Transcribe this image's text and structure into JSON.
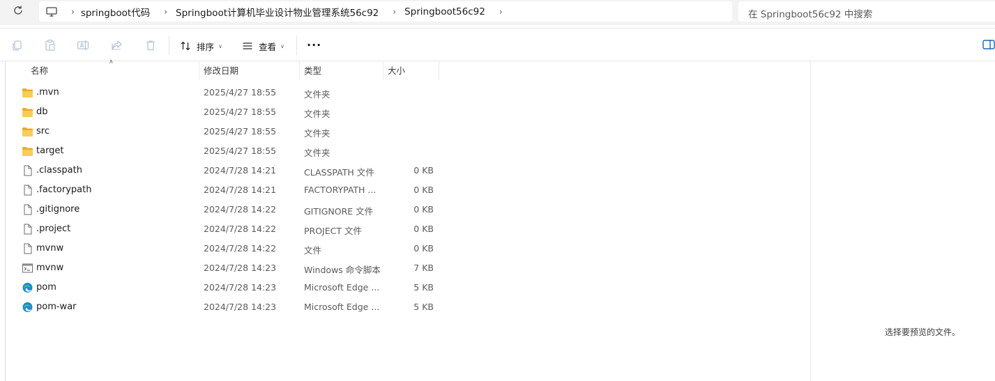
{
  "address_bar": {
    "breadcrumbs": [
      "springboot代码",
      "Springboot计算机毕业设计物业管理系统56c92",
      "Springboot56c92"
    ],
    "search_placeholder": "在 Springboot56c92 中搜索"
  },
  "toolbar": {
    "sort_label": "排序",
    "view_label": "查看",
    "more_label": "···"
  },
  "columns": {
    "name": "名称",
    "modified": "修改日期",
    "type": "类型",
    "size": "大小"
  },
  "files": [
    {
      "name": ".mvn",
      "modified": "2025/4/27 18:55",
      "type": "文件夹",
      "size": "",
      "icon": "folder-icon"
    },
    {
      "name": "db",
      "modified": "2025/4/27 18:55",
      "type": "文件夹",
      "size": "",
      "icon": "folder-icon"
    },
    {
      "name": "src",
      "modified": "2025/4/27 18:55",
      "type": "文件夹",
      "size": "",
      "icon": "folder-icon"
    },
    {
      "name": "target",
      "modified": "2025/4/27 18:55",
      "type": "文件夹",
      "size": "",
      "icon": "folder-icon"
    },
    {
      "name": ".classpath",
      "modified": "2024/7/28 14:21",
      "type": "CLASSPATH 文件",
      "size": "0 KB",
      "icon": "file-icon"
    },
    {
      "name": ".factorypath",
      "modified": "2024/7/28 14:21",
      "type": "FACTORYPATH ...",
      "size": "0 KB",
      "icon": "file-icon"
    },
    {
      "name": ".gitignore",
      "modified": "2024/7/28 14:22",
      "type": "GITIGNORE 文件",
      "size": "0 KB",
      "icon": "file-icon"
    },
    {
      "name": ".project",
      "modified": "2024/7/28 14:22",
      "type": "PROJECT 文件",
      "size": "0 KB",
      "icon": "file-icon"
    },
    {
      "name": "mvnw",
      "modified": "2024/7/28 14:22",
      "type": "文件",
      "size": "0 KB",
      "icon": "file-icon"
    },
    {
      "name": "mvnw",
      "modified": "2024/7/28 14:23",
      "type": "Windows 命令脚本",
      "size": "7 KB",
      "icon": "script-icon"
    },
    {
      "name": "pom",
      "modified": "2024/7/28 14:23",
      "type": "Microsoft Edge ...",
      "size": "5 KB",
      "icon": "edge-icon"
    },
    {
      "name": "pom-war",
      "modified": "2024/7/28 14:23",
      "type": "Microsoft Edge ...",
      "size": "5 KB",
      "icon": "edge-icon"
    }
  ],
  "preview": {
    "empty_message": "选择要预览的文件。"
  },
  "colors": {
    "folder": "#f4c54a",
    "edge": "#1e88d4",
    "toolbar_disabled": "#b8c3d4"
  }
}
